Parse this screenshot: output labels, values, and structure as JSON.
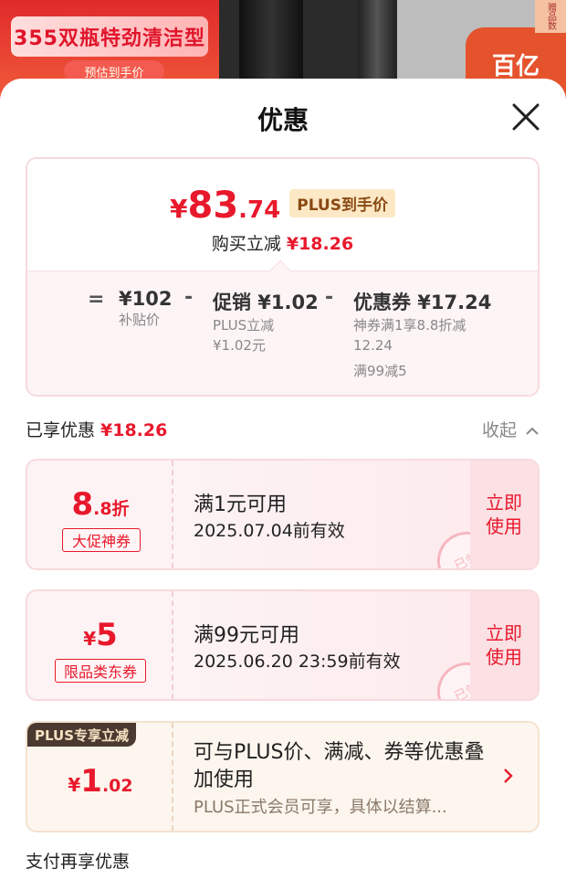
{
  "background": {
    "banner": "355双瓶特劲清洁型",
    "sub": "预估到手价",
    "right_tag": "百亿",
    "side_text": "赠品数"
  },
  "sheet": {
    "title": "优惠"
  },
  "summary": {
    "price_symbol": "¥",
    "price_int": "83",
    "price_dec": ".74",
    "plus_tag": "PLUS到手价",
    "save_label": "购买立减",
    "save_value": "¥18.26",
    "calc": [
      {
        "op": "=",
        "main": "¥102",
        "sub": [
          "补贴价"
        ]
      },
      {
        "op": "-",
        "main": "促销 ¥1.02",
        "sub": [
          "PLUS立减",
          "¥1.02元"
        ]
      },
      {
        "op": "-",
        "main": "优惠券 ¥17.24",
        "sub": [
          "神券满1享8.8折减",
          "12.24",
          "满99减5"
        ]
      }
    ]
  },
  "enjoyed": {
    "label": "已享优惠",
    "value": "¥18.26",
    "collapse": "收起"
  },
  "coupons": [
    {
      "value_main": "8",
      "value_small": ".8折",
      "badge": "大促神券",
      "condition": "满1元可用",
      "date": "2025.07.04前有效",
      "action": [
        "立即",
        "使用"
      ],
      "stamp": "已领"
    },
    {
      "value_prefix": "¥",
      "value_main": "5",
      "badge": "限品类东券",
      "condition": "满99元可用",
      "date": "2025.06.20 23:59前有效",
      "action": [
        "立即",
        "使用"
      ],
      "stamp": "已领"
    }
  ],
  "plus_card": {
    "head": "PLUS专享立减",
    "value_prefix": "¥",
    "value_main": "1",
    "value_small": ".02",
    "text": "可与PLUS价、满减、券等优惠叠加使用",
    "note": "PLUS正式会员可享，具体以结算..."
  },
  "pay_more": "支付再享优惠",
  "colors": {
    "accent_red": "#e8192c",
    "plus_gold": "#fce8c4",
    "plus_dark": "#4a3a2f"
  }
}
